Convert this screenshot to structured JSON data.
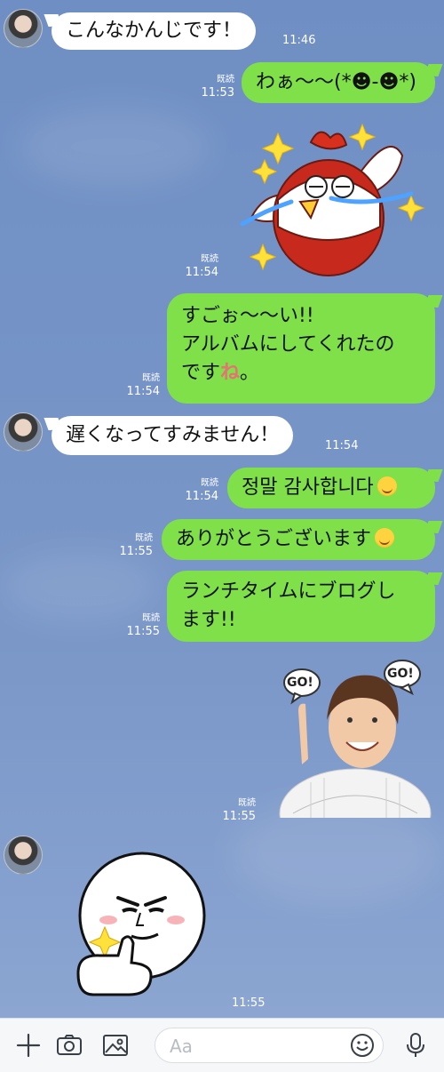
{
  "messages": [
    {
      "side": "in",
      "text": "こんなかんじです！",
      "time": "11:46"
    },
    {
      "side": "out",
      "text": "わぁ〜〜(*☻-☻*)",
      "read": "既読",
      "time": "11:53"
    },
    {
      "side": "out",
      "sticker": "crying-chicken-sticker",
      "read": "既読",
      "time": "11:54"
    },
    {
      "side": "out",
      "lines": [
        "すごぉ〜〜い!!",
        "アルバムにしてくれたの",
        "です"
      ],
      "suffix_glyph": "ね",
      "suffix_tail": "。",
      "read": "既読",
      "time": "11:54"
    },
    {
      "side": "in",
      "text": "遅くなってすみません！",
      "time": "11:54"
    },
    {
      "side": "out",
      "text": "정말 감사합니다",
      "emoji": "smiling-face-emoji",
      "read": "既読",
      "time": "11:54"
    },
    {
      "side": "out",
      "text": "ありがとうございます",
      "emoji": "smiling-face-emoji",
      "read": "既読",
      "time": "11:55"
    },
    {
      "side": "out",
      "lines": [
        "ランチタイムにブログし",
        "ます!!"
      ],
      "read": "既読",
      "time": "11:55"
    },
    {
      "side": "out",
      "sticker": "go-go-photo-sticker",
      "sticker_text": [
        "GO!",
        "GO!"
      ],
      "read": "既読",
      "time": "11:55"
    },
    {
      "side": "in",
      "sticker": "thumbs-up-face-sticker",
      "time": "11:55"
    }
  ],
  "input": {
    "placeholder": "Aa"
  },
  "colors": {
    "out_bubble": "#7fe04a",
    "in_bubble": "#ffffff",
    "background": "#7593c6"
  },
  "icons": [
    "plus-icon",
    "camera-icon",
    "image-icon",
    "emoji-icon",
    "microphone-icon"
  ]
}
